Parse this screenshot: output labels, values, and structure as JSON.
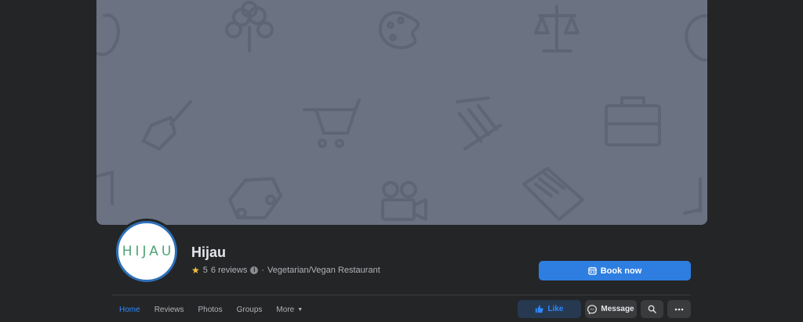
{
  "page": {
    "name": "Hijau",
    "logo_text": "HIJAU",
    "rating": "5",
    "reviews": "6 reviews",
    "info_mark": "i",
    "separator": "·",
    "category": "Vegetarian/Vegan Restaurant"
  },
  "cover": {
    "pattern_icons": [
      "tree-icon",
      "palette-icon",
      "scales-icon",
      "paintbrush-icon",
      "shopping-cart-icon",
      "column-icon",
      "briefcase-icon",
      "car-icon",
      "film-camera-icon",
      "open-book-icon",
      "music-note-icon",
      "apple-icon"
    ]
  },
  "actions": {
    "book_label": "Book now",
    "like_label": "Like",
    "message_label": "Message"
  },
  "tabs": [
    {
      "label": "Home",
      "active": true
    },
    {
      "label": "Reviews",
      "active": false
    },
    {
      "label": "Photos",
      "active": false
    },
    {
      "label": "Groups",
      "active": false
    },
    {
      "label": "More",
      "active": false
    }
  ],
  "colors": {
    "background": "#242526",
    "cover": "#6b7282",
    "accent": "#2d88ff",
    "book_button": "#2d7ee0",
    "logo_green": "#4ca474"
  }
}
